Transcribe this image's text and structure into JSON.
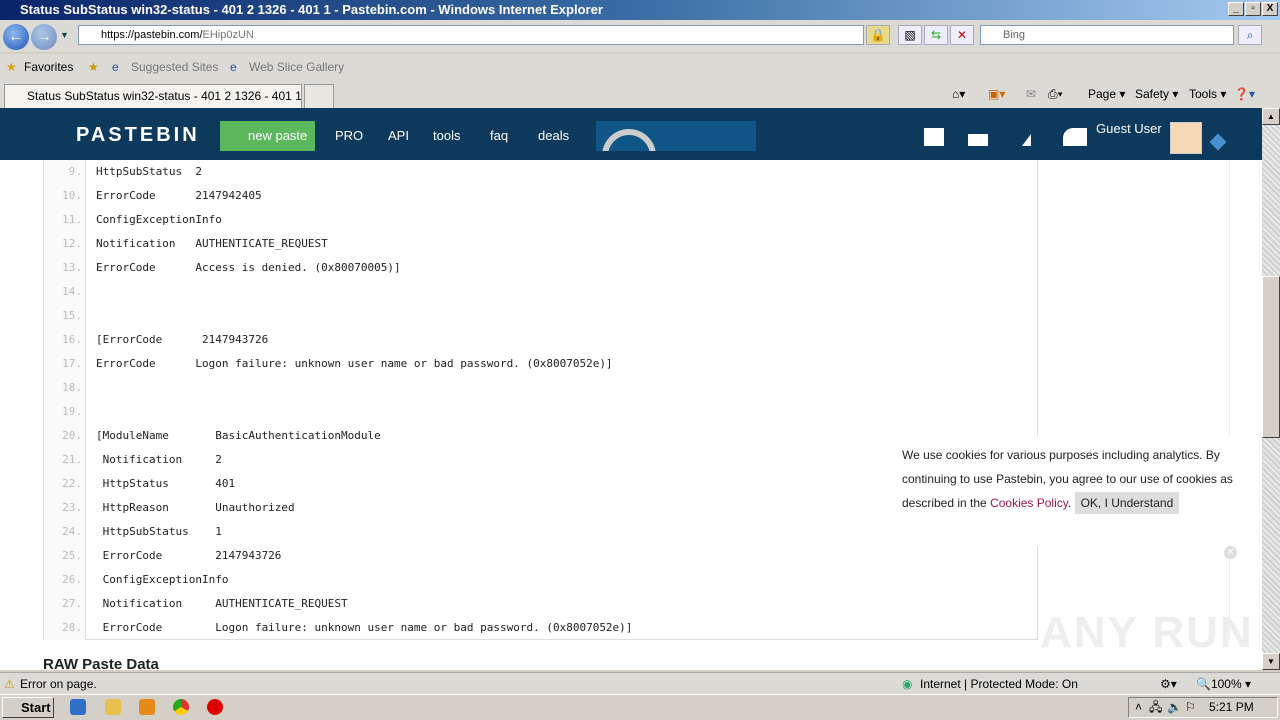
{
  "window": {
    "title": "Status SubStatus win32-status - 401 2 1326 - 401 1 - Pastebin.com - Windows Internet Explorer"
  },
  "browser": {
    "url_host": "https://pastebin.com/",
    "url_path": "EHip0zUN",
    "search_placeholder": "Bing",
    "favorites_label": "Favorites",
    "suggested_sites": "Suggested Sites",
    "web_slice_gallery": "Web Slice Gallery",
    "tab_title": "Status SubStatus win32-status - 401 2 1326 - 401 1 - ...",
    "commands": {
      "page": "Page",
      "safety": "Safety",
      "tools": "Tools"
    }
  },
  "site": {
    "logo": "PASTEBIN",
    "nav": {
      "new_paste": "new paste",
      "pro": "PRO",
      "api": "API",
      "tools": "tools",
      "faq": "faq",
      "deals": "deals"
    },
    "user": "Guest User",
    "accent": "#5cb85c",
    "header_color": "#0d3a5c"
  },
  "code_lines": [
    {
      "n": "9.",
      "text": "HttpSubStatus  2"
    },
    {
      "n": "10.",
      "text": "ErrorCode      2147942405"
    },
    {
      "n": "11.",
      "text": "ConfigExceptionInfo"
    },
    {
      "n": "12.",
      "text": "Notification   AUTHENTICATE_REQUEST"
    },
    {
      "n": "13.",
      "text": "ErrorCode      Access is denied. (0x80070005)]"
    },
    {
      "n": "14.",
      "text": ""
    },
    {
      "n": "15.",
      "text": ""
    },
    {
      "n": "16.",
      "text": "[ErrorCode      2147943726"
    },
    {
      "n": "17.",
      "text": "ErrorCode      Logon failure: unknown user name or bad password. (0x8007052e)]"
    },
    {
      "n": "18.",
      "text": ""
    },
    {
      "n": "19.",
      "text": ""
    },
    {
      "n": "20.",
      "text": "[ModuleName       BasicAuthenticationModule"
    },
    {
      "n": "21.",
      "text": " Notification     2"
    },
    {
      "n": "22.",
      "text": " HttpStatus       401"
    },
    {
      "n": "23.",
      "text": " HttpReason       Unauthorized"
    },
    {
      "n": "24.",
      "text": " HttpSubStatus    1"
    },
    {
      "n": "25.",
      "text": " ErrorCode        2147943726"
    },
    {
      "n": "26.",
      "text": " ConfigExceptionInfo"
    },
    {
      "n": "27.",
      "text": " Notification     AUTHENTICATE_REQUEST"
    },
    {
      "n": "28.",
      "text": " ErrorCode        Logon failure: unknown user name or bad password. (0x8007052e)]"
    }
  ],
  "raw_title": "RAW Paste Data",
  "cookie": {
    "text": "We use cookies for various purposes including analytics. By continuing to use Pastebin, you agree to our use of cookies as described in the ",
    "link": "Cookies Policy",
    "after": ".",
    "button": "OK, I Understand"
  },
  "watermark": "ANY RUN",
  "statusbar": {
    "message": "Error on page.",
    "zone": "Internet | Protected Mode: On",
    "zoom": "100%"
  },
  "taskbar": {
    "start": "Start",
    "clock": "5:21 PM"
  }
}
